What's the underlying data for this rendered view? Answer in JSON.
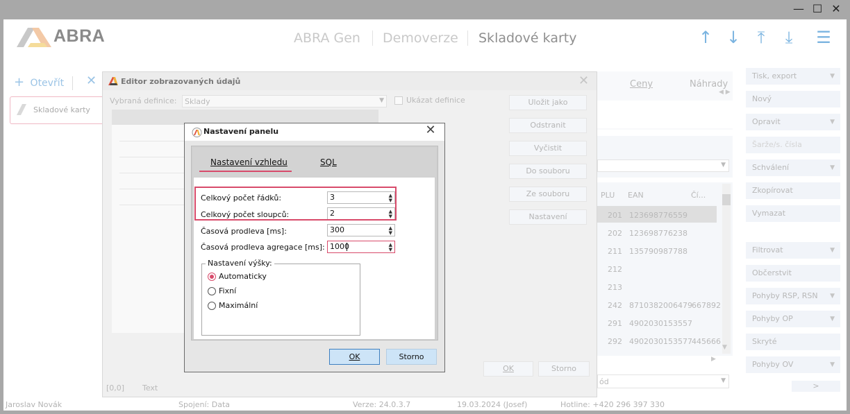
{
  "window": {
    "controls": [
      "—",
      "☐",
      "✕"
    ]
  },
  "header": {
    "brand": "ABRA",
    "crumbs": [
      "ABRA Gen",
      "Demoverze",
      "Skladové karty"
    ]
  },
  "left": {
    "open_label": "Otevřít",
    "tab_label": "Skladové karty"
  },
  "bg_tabs": {
    "ceny": "Ceny",
    "nahrady": "Náhrady"
  },
  "bg_grid": {
    "headers": [
      "PLU",
      "EAN",
      "Čí..."
    ],
    "rows": [
      {
        "plu": "201",
        "ean": "123698776559",
        "extra": ""
      },
      {
        "plu": "202",
        "ean": "123698776238",
        "extra": ""
      },
      {
        "plu": "211",
        "ean": "135790987788",
        "extra": ""
      },
      {
        "plu": "212",
        "ean": "",
        "extra": ""
      },
      {
        "plu": "213",
        "ean": "",
        "extra": ""
      },
      {
        "plu": "242",
        "ean": "8710382006479",
        "extra": "667892"
      },
      {
        "plu": "291",
        "ean": "4902030153557",
        "extra": ""
      },
      {
        "plu": "292",
        "ean": "4902030153577",
        "extra": "445666"
      }
    ],
    "bottom_combo": "ód"
  },
  "right_panel": {
    "items": [
      {
        "label": "Tisk, export",
        "dropdown": true
      },
      {
        "label": "Nový",
        "dropdown": false
      },
      {
        "label": "Opravit",
        "dropdown": true
      },
      {
        "label": "Šarže/s. čísla",
        "dropdown": false
      },
      {
        "label": "Schválení",
        "dropdown": true
      },
      {
        "label": "Zkopírovat",
        "dropdown": false
      },
      {
        "label": "Vymazat",
        "dropdown": false
      },
      {
        "label": "Filtrovat",
        "dropdown": true
      },
      {
        "label": "Občerstvit",
        "dropdown": false
      },
      {
        "label": "Pohyby RSP, RSN",
        "dropdown": true
      },
      {
        "label": "Pohyby OP",
        "dropdown": true
      },
      {
        "label": "Skryté",
        "dropdown": false
      },
      {
        "label": "Pohyby OV",
        "dropdown": true
      }
    ],
    "more": ">"
  },
  "status_bar": {
    "user": "Jaroslav Novák",
    "connection": "Spojení: Data",
    "version": "Verze: 24.0.3.7",
    "date": "19.03.2024 (Josef)",
    "hotline": "Hotline: +420 296 397 330"
  },
  "editor": {
    "title": "Editor zobrazovaných údajů",
    "definition_label": "Vybraná definice:",
    "definition_value": "Sklady",
    "show_defs_label": "Ukázat definice",
    "buttons": [
      "Uložit jako",
      "Odstranit",
      "Vyčistit",
      "Do souboru",
      "Ze souboru",
      "Nastavení"
    ],
    "ok": "OK",
    "cancel": "Storno",
    "coords": "[0,0]",
    "text_label": "Text"
  },
  "dialog": {
    "title": "Nastavení panelu",
    "tabs": [
      "Nastavení vzhledu",
      "SQL"
    ],
    "fields": [
      {
        "label": "Celkový počet řádků:",
        "value": "3"
      },
      {
        "label": "Celkový počet sloupců:",
        "value": "2"
      },
      {
        "label": "Časová prodleva [ms]:",
        "value": "300"
      },
      {
        "label": "Časová prodleva agregace [ms]:",
        "value": "1000"
      }
    ],
    "height_group": {
      "label": "Nastavení výšky:",
      "options": [
        "Automaticky",
        "Fixní",
        "Maximální"
      ],
      "selected": "Automaticky"
    },
    "ok": "OK",
    "cancel": "Storno"
  },
  "colors": {
    "accent": "#d84a6a",
    "brand_blue": "#7bb4e0"
  }
}
